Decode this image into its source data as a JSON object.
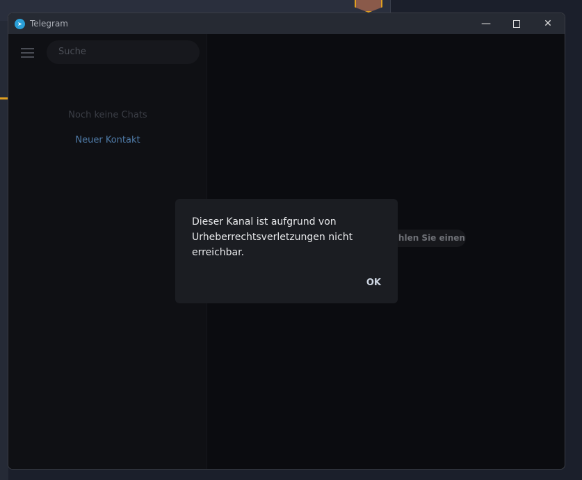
{
  "window": {
    "title": "Telegram"
  },
  "sidebar": {
    "search_placeholder": "Suche",
    "empty_text": "Noch keine Chats",
    "new_contact": "Neuer Kontakt"
  },
  "main": {
    "hint": "Wählen Sie einen Chat, um zu schreiben"
  },
  "dialog": {
    "message": "Dieser Kanal ist aufgrund von Urheberrechtsverletzungen nicht erreichbar.",
    "ok_label": "OK"
  },
  "colors": {
    "accent": "#4f7ba8",
    "titlebar": "#262a33",
    "dialog_bg": "#1b1d22"
  }
}
